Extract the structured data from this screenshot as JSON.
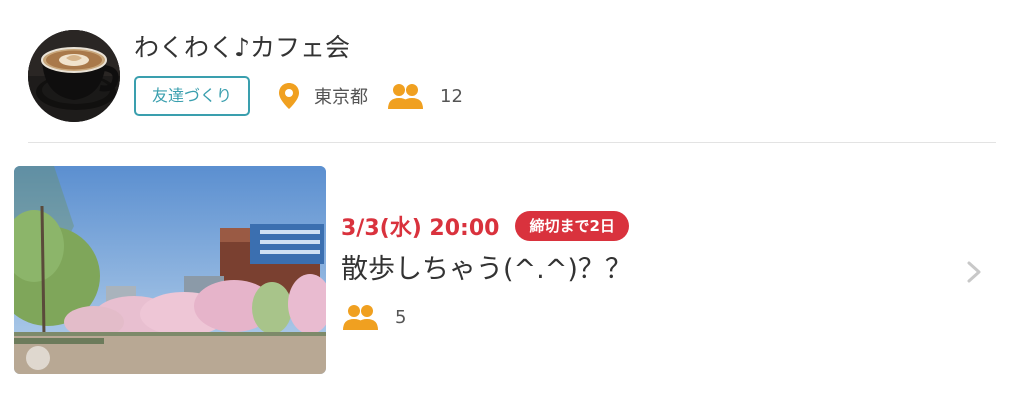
{
  "group": {
    "name": "わくわく♪カフェ会",
    "tag": "友達づくり",
    "location": "東京都",
    "member_count": "12",
    "avatar_icon": "coffee-cup-photo"
  },
  "event": {
    "date": "3/3(水) 20:00",
    "deadline": "締切まで2日",
    "title": "散歩しちゃう(^.^)？？",
    "member_count": "5",
    "thumbnail": "park-cherry-blossom-photo"
  },
  "colors": {
    "accent_teal": "#3a9fae",
    "accent_orange": "#f0a020",
    "date_red": "#d9323d",
    "text": "#333333",
    "divider": "#e3e3e3"
  },
  "icons": {
    "location": "map-pin-icon",
    "members": "people-icon",
    "chevron": "chevron-right-icon"
  }
}
